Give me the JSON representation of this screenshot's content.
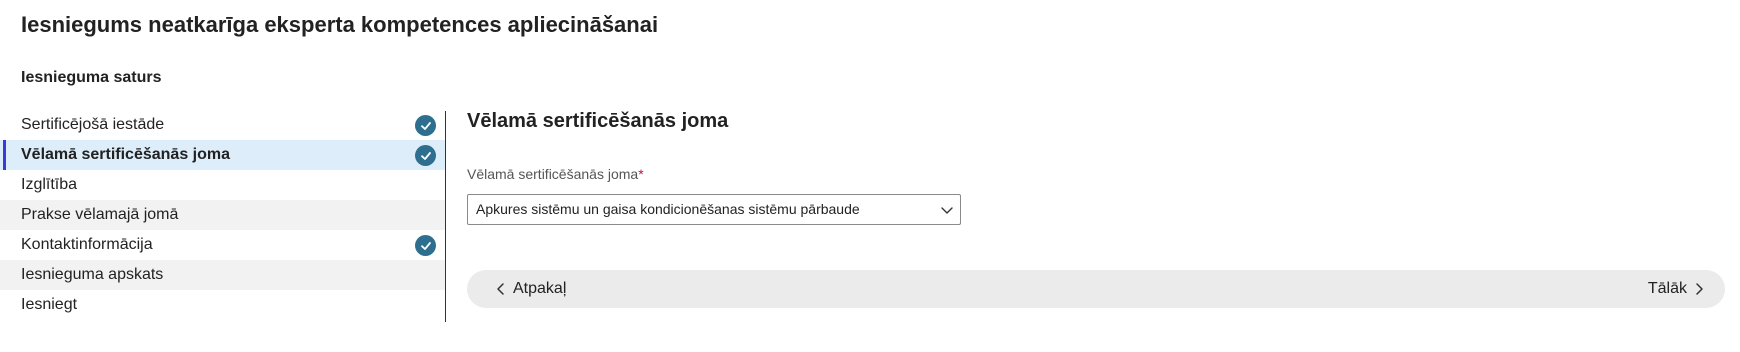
{
  "page": {
    "title": "Iesniegums neatkarīga eksperta kompetences apliecināšanai",
    "section_title": "Iesnieguma saturs"
  },
  "sidebar": {
    "items": [
      {
        "label": "Sertificējošā iestāde",
        "completed": true,
        "active": false
      },
      {
        "label": "Vēlamā sertificēšanās joma",
        "completed": true,
        "active": true
      },
      {
        "label": "Izglītība",
        "completed": false,
        "active": false
      },
      {
        "label": "Prakse vēlamajā jomā",
        "completed": false,
        "active": false
      },
      {
        "label": "Kontaktinformācija",
        "completed": true,
        "active": false
      },
      {
        "label": "Iesnieguma apskats",
        "completed": false,
        "active": false
      },
      {
        "label": "Iesniegt",
        "completed": false,
        "active": false
      }
    ]
  },
  "main": {
    "title": "Vēlamā sertificēšanās joma",
    "field": {
      "label": "Vēlamā sertificēšanās joma",
      "required_mark": "*",
      "value": "Apkures sistēmu un gaisa kondicionēšanas sistēmu pārbaude"
    },
    "nav": {
      "back_label": "Atpakaļ",
      "next_label": "Tālāk"
    }
  },
  "colors": {
    "active_bg": "#ddeefa",
    "active_indicator": "#3a3ad6",
    "check_bg": "#2e6f8f",
    "required": "#c0143c"
  }
}
